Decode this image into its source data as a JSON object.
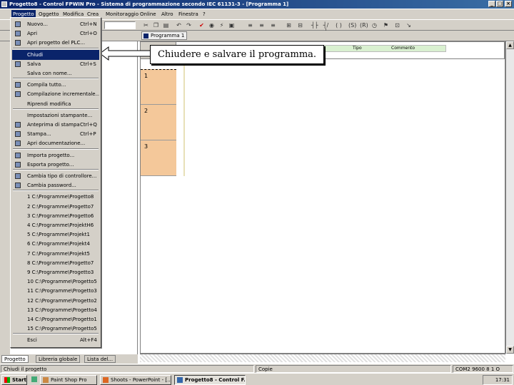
{
  "window": {
    "title": "Progetto8 - Control FPWIN Pro - Sistema di programmazione secondo IEC 61131-3 - [Programma 1]"
  },
  "menubar": {
    "items": [
      "Progetto",
      "Oggetto",
      "Modifica",
      "Crea",
      "Monitoraggio",
      "Online",
      "Altro",
      "Finestra",
      "?"
    ],
    "active": "Progetto"
  },
  "editor": {
    "tab_label": "Programma 1",
    "col_label_1": "Tipo",
    "col_label_2": "Commento",
    "line_numbers": [
      "1",
      "2",
      "3"
    ]
  },
  "callout": {
    "text": "Chiudere e salvare il programma."
  },
  "dropdown": {
    "items": [
      {
        "label": "Nuovo...",
        "shortcut": "Ctrl+N",
        "icon": "new-icon"
      },
      {
        "label": "Apri",
        "shortcut": "Ctrl+O",
        "icon": "open-icon"
      },
      {
        "label": "Apri progetto del PLC...",
        "shortcut": "",
        "icon": "plc-open-icon"
      },
      {
        "label": "Chiudi",
        "shortcut": "",
        "icon": ""
      },
      {
        "label": "Salva",
        "shortcut": "Ctrl+S",
        "icon": "save-icon"
      },
      {
        "label": "Salva con nome...",
        "shortcut": "",
        "icon": ""
      },
      {
        "label": "Compila tutto...",
        "shortcut": "",
        "icon": "compile-icon"
      },
      {
        "label": "Compilazione incrementale...",
        "shortcut": "",
        "icon": "compile-inc-icon"
      },
      {
        "label": "Riprendi modifica",
        "shortcut": "",
        "icon": ""
      },
      {
        "label": "Impostazioni stampante...",
        "shortcut": "",
        "icon": ""
      },
      {
        "label": "Anteprima di stampa",
        "shortcut": "Ctrl+Q",
        "icon": "preview-icon"
      },
      {
        "label": "Stampa...",
        "shortcut": "Ctrl+P",
        "icon": "print-icon"
      },
      {
        "label": "Apri documentazione...",
        "shortcut": "",
        "icon": "docs-icon"
      },
      {
        "label": "Importa progetto...",
        "shortcut": "",
        "icon": "import-icon"
      },
      {
        "label": "Esporta progetto...",
        "shortcut": "",
        "icon": "export-icon"
      },
      {
        "label": "Cambia tipo di controllore...",
        "shortcut": "",
        "icon": "controller-icon"
      },
      {
        "label": "Cambia password...",
        "shortcut": "",
        "icon": "key-icon"
      },
      {
        "label": "1 C:\\Programme\\Progetto8",
        "shortcut": "",
        "icon": ""
      },
      {
        "label": "2 C:\\Programme\\Progetto7",
        "shortcut": "",
        "icon": ""
      },
      {
        "label": "3 C:\\Programme\\Progetto6",
        "shortcut": "",
        "icon": ""
      },
      {
        "label": "4 C:\\Programme\\ProjektH6",
        "shortcut": "",
        "icon": ""
      },
      {
        "label": "5 C:\\Programme\\Projekt1",
        "shortcut": "",
        "icon": ""
      },
      {
        "label": "6 C:\\Programme\\Projekt4",
        "shortcut": "",
        "icon": ""
      },
      {
        "label": "7 C:\\Programme\\Projekt5",
        "shortcut": "",
        "icon": ""
      },
      {
        "label": "8 C:\\Programme\\Progetto7",
        "shortcut": "",
        "icon": ""
      },
      {
        "label": "9 C:\\Programme\\Progetto3",
        "shortcut": "",
        "icon": ""
      },
      {
        "label": "10 C:\\Programme\\Progetto5",
        "shortcut": "",
        "icon": ""
      },
      {
        "label": "11 C:\\Programme\\Progetto3",
        "shortcut": "",
        "icon": ""
      },
      {
        "label": "12 C:\\Programme\\Progetto2",
        "shortcut": "",
        "icon": ""
      },
      {
        "label": "13 C:\\Programme\\Progetto4",
        "shortcut": "",
        "icon": ""
      },
      {
        "label": "14 C:\\Programme\\Progetto1",
        "shortcut": "",
        "icon": ""
      },
      {
        "label": "15 C:\\Programme\\Progetto5",
        "shortcut": "",
        "icon": ""
      },
      {
        "label": "Esci",
        "shortcut": "Alt+F4",
        "icon": ""
      }
    ],
    "highlighted": "Chiudi"
  },
  "bottomtabs": [
    "Progetto",
    "Libreria globale",
    "Lista del..."
  ],
  "status": {
    "left": "Chiudi il progetto",
    "mode": "Copie",
    "right": "COM2 9600 8 1 O"
  },
  "taskbar": {
    "start": "Start",
    "buttons": [
      "Paint Shop Pro",
      "Shoots - PowerPoint - [..."
    ],
    "active_button": "Progetto8 - Control F...",
    "clock": "17:31"
  },
  "colors": {
    "titlebar": "#0a246a",
    "highlight": "#0a246a",
    "line_cell": "#f4c89a",
    "header_green": "#d9f0d0"
  }
}
